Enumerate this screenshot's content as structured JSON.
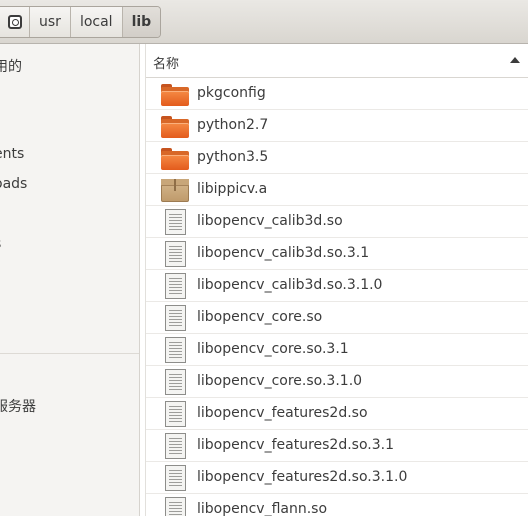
{
  "breadcrumb": {
    "home_icon": "home-folder-icon",
    "items": [
      "usr",
      "local",
      "lib"
    ],
    "active": "lib"
  },
  "sidebar": {
    "items": [
      {
        "label": "用的"
      },
      {
        "label": "ents"
      },
      {
        "label": "oads"
      },
      {
        "label": "s"
      },
      {
        "label": "服务器"
      }
    ]
  },
  "filelist": {
    "column_header": "名称",
    "sort": "ascending",
    "files": [
      {
        "name": "pkgconfig",
        "icon": "folder-icon"
      },
      {
        "name": "python2.7",
        "icon": "folder-icon"
      },
      {
        "name": "python3.5",
        "icon": "folder-icon"
      },
      {
        "name": "libippicv.a",
        "icon": "archive-icon"
      },
      {
        "name": "libopencv_calib3d.so",
        "icon": "text-file-icon"
      },
      {
        "name": "libopencv_calib3d.so.3.1",
        "icon": "text-file-icon"
      },
      {
        "name": "libopencv_calib3d.so.3.1.0",
        "icon": "text-file-icon"
      },
      {
        "name": "libopencv_core.so",
        "icon": "text-file-icon"
      },
      {
        "name": "libopencv_core.so.3.1",
        "icon": "text-file-icon"
      },
      {
        "name": "libopencv_core.so.3.1.0",
        "icon": "text-file-icon"
      },
      {
        "name": "libopencv_features2d.so",
        "icon": "text-file-icon"
      },
      {
        "name": "libopencv_features2d.so.3.1",
        "icon": "text-file-icon"
      },
      {
        "name": "libopencv_features2d.so.3.1.0",
        "icon": "text-file-icon"
      },
      {
        "name": "libopencv_flann.so",
        "icon": "text-file-icon"
      }
    ]
  }
}
